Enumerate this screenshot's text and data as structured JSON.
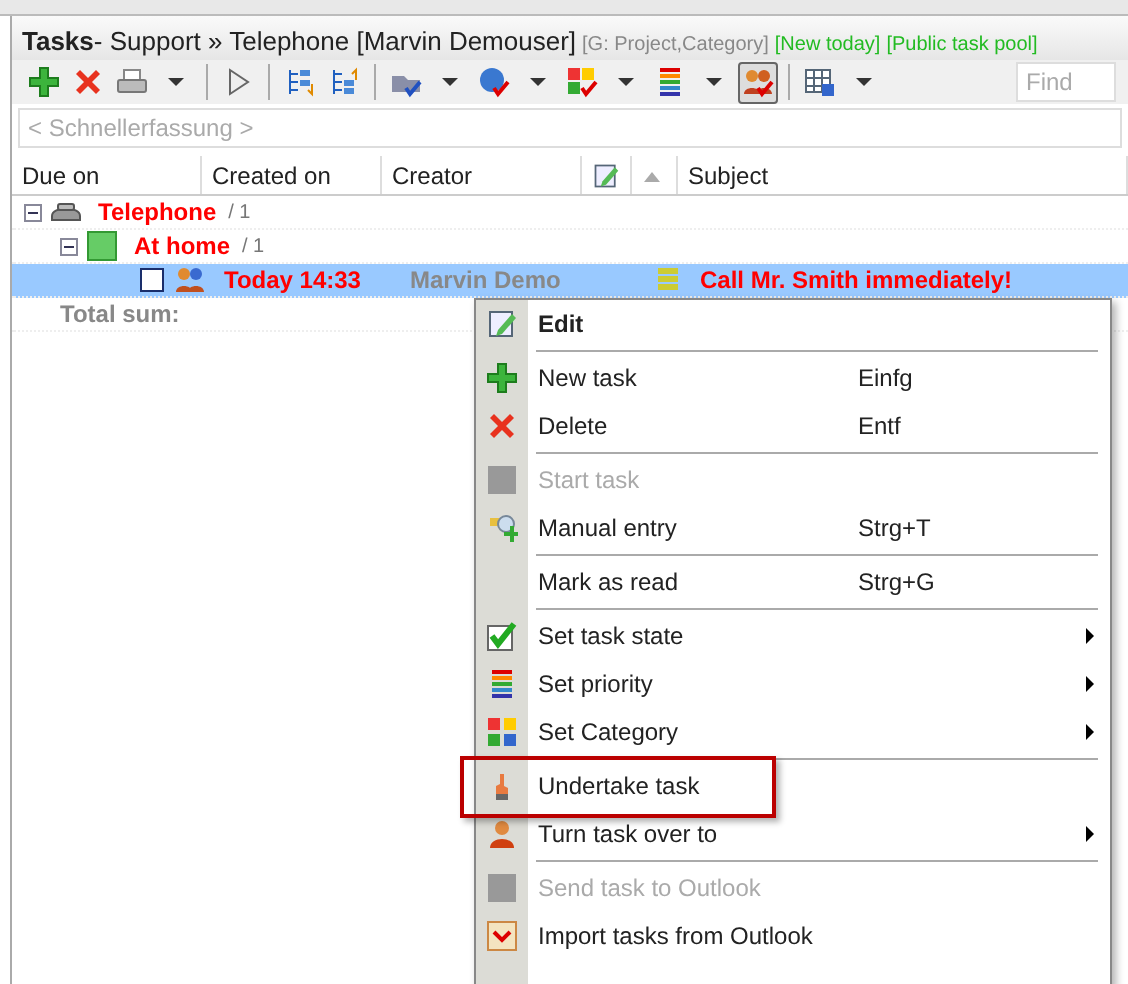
{
  "window": {
    "title": "Tasks",
    "path": " - Support » Telephone [Marvin Demouser]",
    "filters": [
      {
        "text": "[G: Project,Category]",
        "kind": "grouping"
      },
      {
        "text": "[New today]",
        "kind": "filter"
      },
      {
        "text": "[Public task pool]",
        "kind": "filter"
      }
    ]
  },
  "toolbar": {
    "groups": [
      {
        "buttons": [
          {
            "dropdown": false,
            "pressed": false
          },
          {
            "dropdown": false,
            "pressed": false
          },
          {
            "dropdown": true,
            "pressed": false
          }
        ]
      },
      {
        "buttons": [
          {
            "dropdown": false,
            "pressed": false
          }
        ]
      },
      {
        "buttons": [
          {
            "dropdown": false,
            "pressed": false
          },
          {
            "dropdown": false,
            "pressed": false
          }
        ]
      },
      {
        "buttons": [
          {
            "dropdown": true,
            "pressed": false
          },
          {
            "dropdown": true,
            "pressed": false
          },
          {
            "dropdown": true,
            "pressed": false
          },
          {
            "dropdown": true,
            "pressed": false
          },
          {
            "dropdown": false,
            "pressed": true
          }
        ]
      },
      {
        "buttons": [
          {
            "dropdown": true,
            "pressed": false
          }
        ]
      }
    ]
  },
  "search": {
    "placeholder": "Find"
  },
  "quick_entry": {
    "placeholder": "< Schnellerfassung >"
  },
  "table": {
    "columns": [
      {
        "label": "Due on",
        "kind": "text"
      },
      {
        "label": "Created on",
        "kind": "text"
      },
      {
        "label": "Creator",
        "kind": "text"
      },
      {
        "kind": "edit-icon"
      },
      {
        "kind": "sort-arrow"
      },
      {
        "label": "Subject",
        "kind": "text"
      }
    ],
    "groups": [
      {
        "label": "Telephone",
        "count": "/ 1",
        "expanded": true,
        "children": [
          {
            "label": "At home",
            "count": "/ 1",
            "expanded": true,
            "tasks": [
              {
                "checked": false,
                "selected": true,
                "due": "Today 14:33",
                "creator": "Marvin Demo",
                "subject": "Call Mr. Smith immediately!"
              }
            ]
          }
        ]
      }
    ],
    "total": {
      "label": "Total sum:"
    }
  },
  "context_menu": [
    {
      "kind": "item",
      "label": "Edit",
      "default": true,
      "disabled": false,
      "submenu": false,
      "highlighted": false
    },
    {
      "kind": "separator"
    },
    {
      "kind": "item",
      "label": "New task",
      "shortcut": "Einfg",
      "default": false,
      "disabled": false,
      "submenu": false,
      "highlighted": false
    },
    {
      "kind": "item",
      "label": "Delete",
      "shortcut": "Entf",
      "default": false,
      "disabled": false,
      "submenu": false,
      "highlighted": false
    },
    {
      "kind": "separator"
    },
    {
      "kind": "item",
      "label": "Start task",
      "default": false,
      "disabled": true,
      "submenu": false,
      "highlighted": false
    },
    {
      "kind": "item",
      "label": "Manual entry",
      "shortcut": "Strg+T",
      "default": false,
      "disabled": false,
      "submenu": false,
      "highlighted": false
    },
    {
      "kind": "separator"
    },
    {
      "kind": "item",
      "label": "Mark as read",
      "shortcut": "Strg+G",
      "default": false,
      "disabled": false,
      "submenu": false,
      "highlighted": false
    },
    {
      "kind": "separator"
    },
    {
      "kind": "item",
      "label": "Set task state",
      "default": false,
      "disabled": false,
      "submenu": true,
      "highlighted": false
    },
    {
      "kind": "item",
      "label": "Set priority",
      "default": false,
      "disabled": false,
      "submenu": true,
      "highlighted": false
    },
    {
      "kind": "item",
      "label": "Set Category",
      "default": false,
      "disabled": false,
      "submenu": true,
      "highlighted": false
    },
    {
      "kind": "separator"
    },
    {
      "kind": "item",
      "label": "Undertake task",
      "default": false,
      "disabled": false,
      "submenu": false,
      "highlighted": true
    },
    {
      "kind": "item",
      "label": "Turn task over to",
      "default": false,
      "disabled": false,
      "submenu": true,
      "highlighted": false
    },
    {
      "kind": "separator"
    },
    {
      "kind": "item",
      "label": "Send task to Outlook",
      "default": false,
      "disabled": true,
      "submenu": false,
      "highlighted": false
    },
    {
      "kind": "item",
      "label": "Import tasks from Outlook",
      "default": false,
      "disabled": false,
      "submenu": false,
      "highlighted": false
    }
  ]
}
